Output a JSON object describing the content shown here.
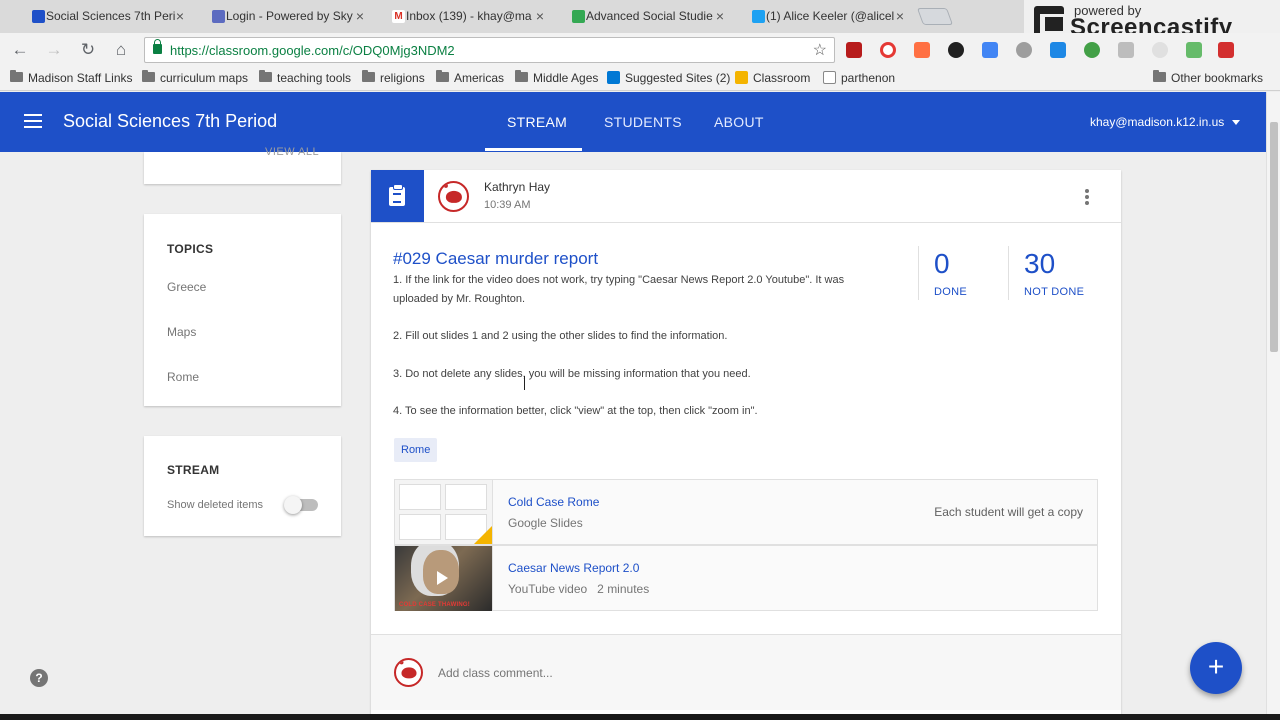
{
  "browser": {
    "tabs": [
      {
        "label": "Social Sciences 7th Peri",
        "favicon": "classroom-icon",
        "color": "#1e50c8",
        "glyph": "▣"
      },
      {
        "label": "Login - Powered by Sky",
        "favicon": "skyward-icon",
        "color": "#5c6bc0",
        "glyph": "◢"
      },
      {
        "label": "Inbox (139) - khay@ma",
        "favicon": "gmail-icon",
        "color": "#d93025",
        "glyph": "M"
      },
      {
        "label": "Advanced Social Studie",
        "favicon": "drive-icon",
        "color": "#34a853",
        "glyph": "▲"
      },
      {
        "label": "(1) Alice Keeler (@alicel",
        "favicon": "twitter-icon",
        "color": "#1da1f2",
        "glyph": "✦"
      }
    ],
    "close_glyph": "×",
    "url": "https://classroom.google.com/c/ODQ0Mjg3NDM2",
    "nav": {
      "back": "←",
      "forward": "→",
      "reload": "↻",
      "home": "⌂"
    },
    "star": "☆",
    "bookmarks": [
      {
        "label": "Madison Staff Links",
        "type": "folder"
      },
      {
        "label": "curriculum maps",
        "type": "folder"
      },
      {
        "label": "teaching tools",
        "type": "folder"
      },
      {
        "label": "religions",
        "type": "folder"
      },
      {
        "label": "Americas",
        "type": "folder"
      },
      {
        "label": "Middle Ages",
        "type": "folder"
      },
      {
        "label": "Suggested Sites (2)",
        "type": "bing"
      },
      {
        "label": "Classroom",
        "type": "classroom"
      },
      {
        "label": "parthenon",
        "type": "page"
      }
    ],
    "other_bookmarks": "Other bookmarks"
  },
  "screencastify": {
    "powered_by": "powered by",
    "name": "Screencastify Lite"
  },
  "app": {
    "class_name": "Social Sciences 7th Period",
    "tabs": [
      "STREAM",
      "STUDENTS",
      "ABOUT"
    ],
    "active_tab": "STREAM",
    "account": "khay@madison.k12.in.us",
    "accent": "#1e50c8"
  },
  "sidebar": {
    "view_all": "VIEW ALL",
    "topics_heading": "TOPICS",
    "topics": [
      "Greece",
      "Maps",
      "Rome"
    ],
    "stream_heading": "STREAM",
    "show_deleted_label": "Show deleted items",
    "show_deleted_on": false
  },
  "post": {
    "author": "Kathryn Hay",
    "time": "10:39 AM",
    "title": "#029 Caesar murder report",
    "lines": [
      "1. If the link for the video does not work, try typing \"Caesar News Report 2.0 Youtube\". It was uploaded by Mr. Roughton.",
      "2. Fill out slides 1 and 2 using the other slides to find the information.",
      "3. Do not delete any slides, you will be missing information that you need.",
      "4. To see the information better, click \"view\" at the top, then click \"zoom in\"."
    ],
    "done_count": "0",
    "done_label": "DONE",
    "not_done_count": "30",
    "not_done_label": "NOT DONE",
    "topic_chip": "Rome",
    "attachments": [
      {
        "title": "Cold Case Rome",
        "subtitle": "Google Slides",
        "note": "Each student will get a copy"
      },
      {
        "title": "Caesar News Report 2.0",
        "subtitle": "YouTube video   2 minutes",
        "thumb_caption": "COLD CASE THAWING!"
      }
    ],
    "comment_placeholder": "Add class comment..."
  },
  "fab_label": "+",
  "help_label": "?"
}
